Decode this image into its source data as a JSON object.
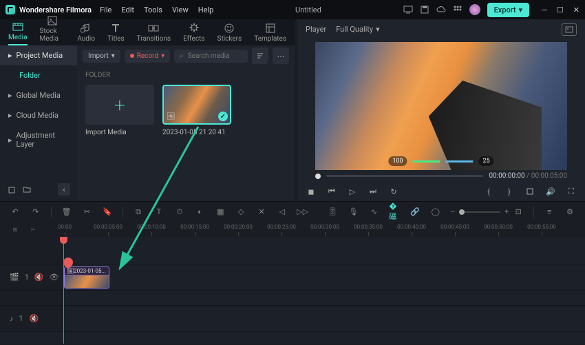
{
  "app": {
    "name": "Wondershare Filmora",
    "title": "Untitled"
  },
  "menu": [
    "File",
    "Edit",
    "Tools",
    "View",
    "Help"
  ],
  "export_label": "Export",
  "mode_tabs": [
    {
      "label": "Media",
      "active": true
    },
    {
      "label": "Stock Media"
    },
    {
      "label": "Audio"
    },
    {
      "label": "Titles"
    },
    {
      "label": "Transitions"
    },
    {
      "label": "Effects"
    },
    {
      "label": "Stickers"
    },
    {
      "label": "Templates"
    }
  ],
  "sidebar": {
    "items": [
      {
        "label": "Project Media",
        "type": "head"
      },
      {
        "label": "Folder",
        "type": "active"
      },
      {
        "label": "Global Media"
      },
      {
        "label": "Cloud Media"
      },
      {
        "label": "Adjustment Layer"
      }
    ]
  },
  "media_toolbar": {
    "import": "Import",
    "record": "Record",
    "search_placeholder": "Search media"
  },
  "folder_label": "FOLDER",
  "thumbs": {
    "import": "Import Media",
    "clip": "2023-01-05 21 20 41"
  },
  "player": {
    "label": "Player",
    "quality": "Full Quality",
    "hud": {
      "hp": "100",
      "armor": "25"
    },
    "current": "00:00:00:00",
    "duration": "00:00:05:00"
  },
  "ruler": [
    "00:00",
    "00:00:05:00",
    "00:00:10:00",
    "00:00:15:00",
    "00:00:20:00",
    "00:00:25:00",
    "00:00:30:00",
    "00:00:35:00",
    "00:00:40:00",
    "00:00:45:00",
    "00:00:50:00",
    "00:00:55:00"
  ],
  "tracks": {
    "video": {
      "num": "1",
      "clip_label": "2023-01-05..."
    },
    "audio": {
      "num": "1"
    }
  }
}
